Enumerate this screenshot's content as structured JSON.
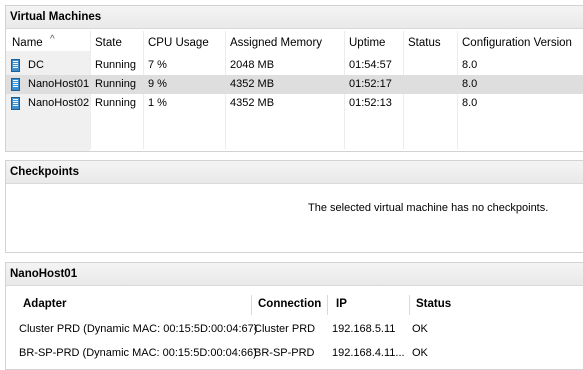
{
  "vm_panel": {
    "title": "Virtual Machines",
    "columns": [
      "Name",
      "State",
      "CPU Usage",
      "Assigned Memory",
      "Uptime",
      "Status",
      "Configuration Version"
    ],
    "rows": [
      {
        "name": "DC",
        "state": "Running",
        "cpu": "7 %",
        "memory": "2048 MB",
        "uptime": "01:54:57",
        "status": "",
        "config": "8.0"
      },
      {
        "name": "NanoHost01",
        "state": "Running",
        "cpu": "9 %",
        "memory": "4352 MB",
        "uptime": "01:52:17",
        "status": "",
        "config": "8.0"
      },
      {
        "name": "NanoHost02",
        "state": "Running",
        "cpu": "1 %",
        "memory": "4352 MB",
        "uptime": "01:52:13",
        "status": "",
        "config": "8.0"
      }
    ]
  },
  "checkpoints_panel": {
    "title": "Checkpoints",
    "message": "The selected virtual machine has no checkpoints."
  },
  "details_panel": {
    "title": "NanoHost01",
    "columns": [
      "Adapter",
      "Connection",
      "IP",
      "Status"
    ],
    "rows": [
      {
        "adapter": "Cluster PRD (Dynamic MAC: 00:15:5D:00:04:67)",
        "connection": "Cluster PRD",
        "ip": "192.168.5.11",
        "status": "OK"
      },
      {
        "adapter": "BR-SP-PRD (Dynamic MAC: 00:15:5D:00:04:66)",
        "connection": "BR-SP-PRD",
        "ip": "192.168.4.11...",
        "status": "OK"
      }
    ]
  },
  "colors": {
    "selected_row": "#dedede",
    "header_bg": "#ececec",
    "vm_icon": "#3b8fd0"
  }
}
